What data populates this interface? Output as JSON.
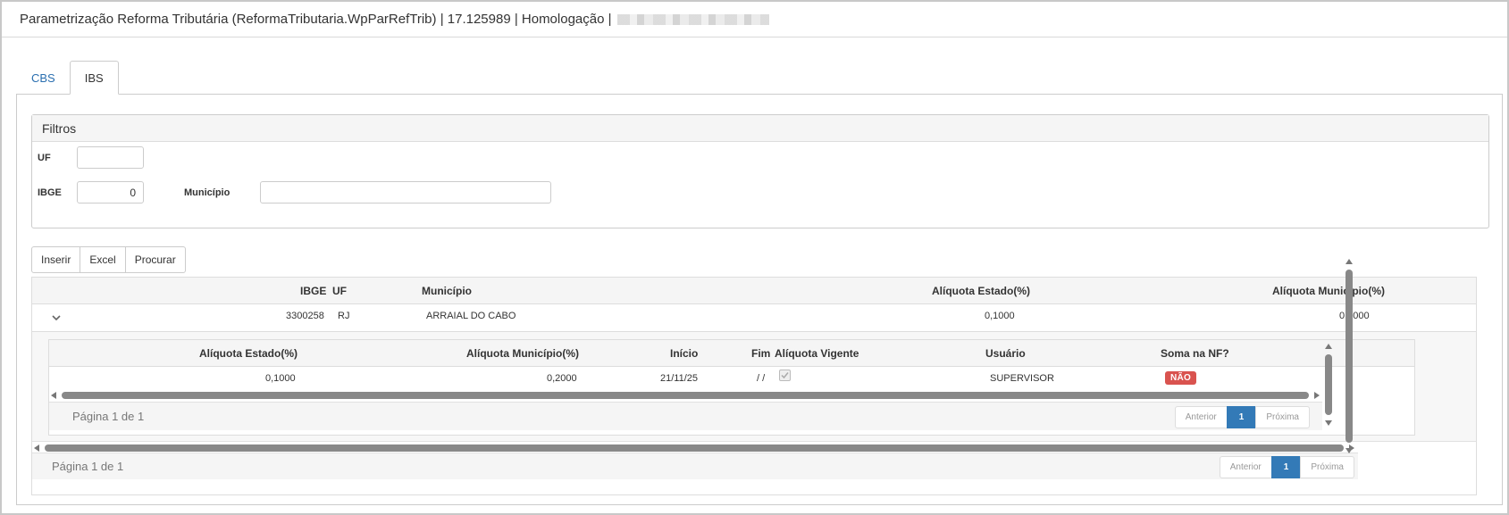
{
  "window": {
    "title": "Parametrização Reforma Tributária (ReformaTributaria.WpParRefTrib) | 17.125989 | Homologação |"
  },
  "tabs": [
    {
      "label": "CBS"
    },
    {
      "label": "IBS"
    }
  ],
  "filters": {
    "title": "Filtros",
    "uf_label": "UF",
    "uf_value": "",
    "ibge_label": "IBGE",
    "ibge_value": "0",
    "municipio_label": "Município",
    "municipio_value": ""
  },
  "toolbar": {
    "insert_label": "Inserir",
    "excel_label": "Excel",
    "search_label": "Procurar"
  },
  "grid": {
    "columns": {
      "ibge": "IBGE",
      "uf": "UF",
      "municipio": "Município",
      "aliq_estado": "Alíquota Estado(%)",
      "aliq_municipio": "Alíquota Município(%)"
    },
    "rows": [
      {
        "ibge": "3300258",
        "uf": "RJ",
        "municipio": "ARRAIAL DO CABO",
        "aliq_estado": "0,1000",
        "aliq_municipio": "0,2000"
      }
    ],
    "detail": {
      "columns": {
        "aliq_estado": "Alíquota Estado(%)",
        "aliq_municipio": "Alíquota Município(%)",
        "inicio": "Início",
        "fim": "Fim",
        "vigente": "Alíquota Vigente",
        "usuario": "Usuário",
        "soma_nf": "Soma na NF?"
      },
      "rows": [
        {
          "aliq_estado": "0,1000",
          "aliq_municipio": "0,2000",
          "inicio": "21/11/25",
          "fim": "/ /",
          "vigente": true,
          "usuario": "SUPERVISOR",
          "soma_nf": "NÃO"
        }
      ],
      "pager": {
        "text": "Página 1 de 1",
        "prev": "Anterior",
        "page": "1",
        "next": "Próxima"
      }
    },
    "pager": {
      "text": "Página 1 de 1",
      "prev": "Anterior",
      "page": "1",
      "next": "Próxima"
    }
  },
  "colors": {
    "accent": "#337ab7",
    "danger": "#d9534f",
    "link": "#2a6fb0"
  }
}
